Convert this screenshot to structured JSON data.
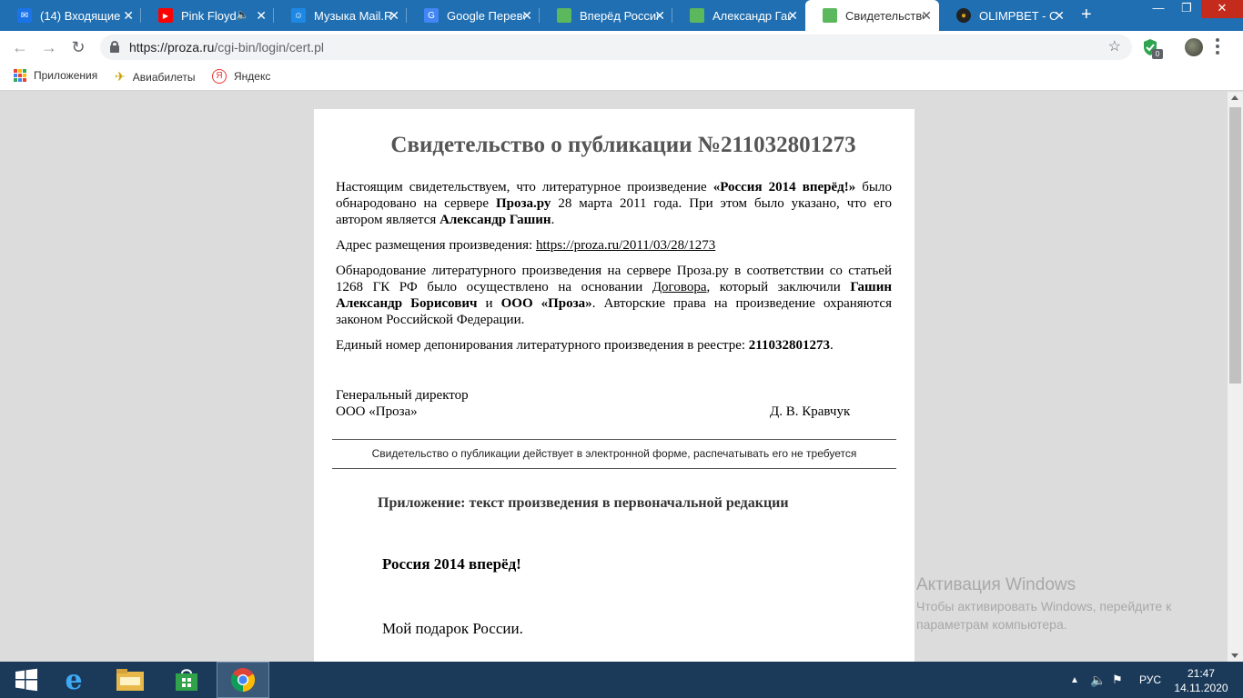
{
  "browser": {
    "tabs": [
      {
        "title": "(14) Входящие",
        "icon": "mail-icon",
        "color": "#1a73e8",
        "active": false
      },
      {
        "title": "Pink Floyd",
        "icon": "youtube-icon",
        "color": "#ff0000",
        "active": false,
        "audio": true
      },
      {
        "title": "Музыка Mail.R",
        "icon": "music-icon",
        "color": "#1e88e5",
        "active": false
      },
      {
        "title": "Google Перевод",
        "icon": "google-translate-icon",
        "color": "#4285f4",
        "active": false
      },
      {
        "title": "Вперёд Россия",
        "icon": "proza-icon",
        "color": "#5cb85c",
        "active": false
      },
      {
        "title": "Александр Гаш",
        "icon": "proza-icon",
        "color": "#5cb85c",
        "active": false
      },
      {
        "title": "Свидетельство",
        "icon": "proza-icon",
        "color": "#5cb85c",
        "active": true
      },
      {
        "title": "OLIMPBET - Сп",
        "icon": "olimpbet-icon",
        "color": "#d4a017",
        "active": false
      }
    ],
    "url_host": "https://proza.ru",
    "url_path": "/cgi-bin/login/cert.pl",
    "extension_badge": "0",
    "bookmarks": [
      {
        "label": "Приложения",
        "icon": "apps-icon"
      },
      {
        "label": "Авиабилеты",
        "icon": "plane-icon"
      },
      {
        "label": "Яндекс",
        "icon": "yandex-icon"
      }
    ]
  },
  "certificate": {
    "title": "Свидетельство о публикации №211032801273",
    "p1_a": "Настоящим свидетельствуем, что литературное произведение ",
    "p1_work": "«Россия 2014 вперёд!»",
    "p1_b": " было обнародовано на сервере ",
    "p1_site": "Проза.ру",
    "p1_c": " 28 марта 2011 года. При этом было указано, что его автором является ",
    "p1_author": "Александр Гашин",
    "p1_d": ".",
    "p2_label": "Адрес размещения произведения: ",
    "p2_link": "https://proza.ru/2011/03/28/1273",
    "p3_a": "Обнародование литературного произведения на сервере Проза.ру в соответствии со статьей 1268 ГК РФ было осуществлено на основании ",
    "p3_link": "Договора",
    "p3_b": ", который заключили ",
    "p3_party1": "Гашин Александр Борисович",
    "p3_c": " и ",
    "p3_party2": "ООО «Проза»",
    "p3_d": ". Авторские права на произведение охраняются законом Российской Федерации.",
    "p4_a": "Единый номер депонирования литературного произведения в реестре: ",
    "p4_number": "211032801273",
    "p4_b": ".",
    "sig_position": "Генеральный директор",
    "sig_company": "ООО «Проза»",
    "sig_name": "Д. В. Кравчук",
    "note": "Свидетельство о публикации действует в электронной форме, распечатывать его не требуется",
    "appendix": "Приложение: текст произведения в первоначальной редакции",
    "work_title": "Россия 2014 вперёд!",
    "work_first_line": "Мой подарок России."
  },
  "watermark": {
    "title": "Активация Windows",
    "subtitle": "Чтобы активировать Windows, перейдите к параметрам компьютера."
  },
  "taskbar": {
    "language": "РУС",
    "time": "21:47",
    "date": "14.11.2020",
    "items": [
      "windows-start-icon",
      "internet-explorer-icon",
      "file-explorer-icon",
      "store-icon",
      "chrome-icon"
    ]
  }
}
